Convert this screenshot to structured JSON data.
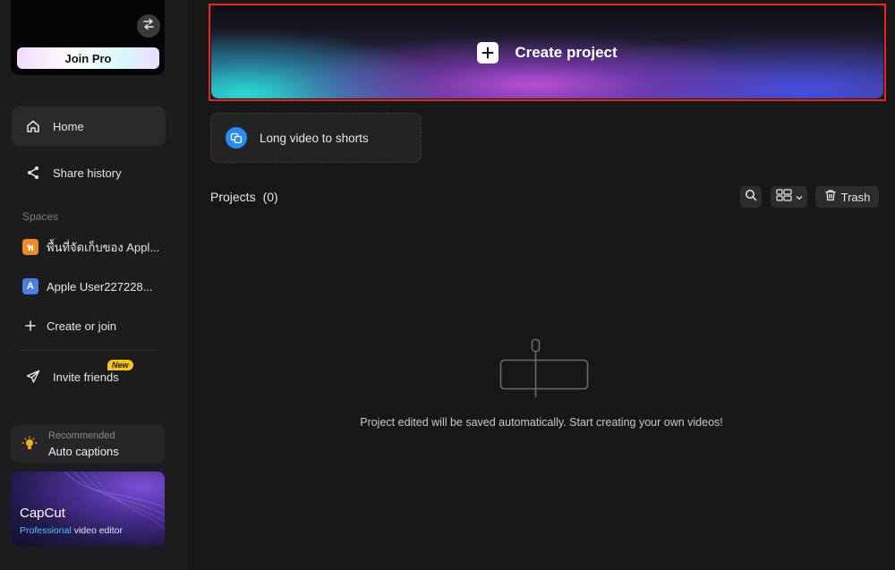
{
  "sidebar": {
    "join_pro_label": "Join Pro",
    "nav": [
      {
        "label": "Home",
        "icon": "home-icon",
        "active": true
      },
      {
        "label": "Share history",
        "icon": "share-icon",
        "active": false
      }
    ],
    "spaces_label": "Spaces",
    "spaces": [
      {
        "badge": "พ",
        "label": "พื้นที่จัดเก็บของ Appl...",
        "color": "#f08a24"
      },
      {
        "badge": "A",
        "label": "Apple User227228...",
        "color": "#4a7fe8"
      }
    ],
    "create_or_join_label": "Create or join",
    "invite_label": "Invite friends",
    "new_badge": "New",
    "recommended": {
      "small": "Recommended",
      "title": "Auto captions"
    },
    "promo": {
      "title": "CapCut",
      "subtitle_highlight": "Professional",
      "subtitle_rest": " video editor"
    }
  },
  "main": {
    "create_project_label": "Create project",
    "long_video_label": "Long video to shorts",
    "projects_label": "Projects",
    "projects_count": "(0)",
    "trash_label": "Trash",
    "empty_text": "Project edited will be saved automatically. Start creating your own videos!"
  },
  "colors": {
    "accent_red_border": "#e8261c",
    "link_blue": "#2b8cf0",
    "new_badge": "#f5c518"
  }
}
